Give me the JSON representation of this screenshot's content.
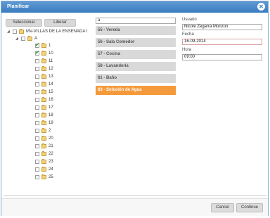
{
  "dialog": {
    "title": "Planificar"
  },
  "toolbar": {
    "select_label": "Seleccionar",
    "release_label": "Liberar"
  },
  "tree": {
    "root_label": "MV-VILLAS DE LA ENSENADA I",
    "group_label": "A",
    "items": [
      {
        "label": "1",
        "checked": true
      },
      {
        "label": "10",
        "checked": true
      },
      {
        "label": "11",
        "checked": false
      },
      {
        "label": "12",
        "checked": false
      },
      {
        "label": "13",
        "checked": false
      },
      {
        "label": "14",
        "checked": false
      },
      {
        "label": "15",
        "checked": false
      },
      {
        "label": "16",
        "checked": false
      },
      {
        "label": "17",
        "checked": false
      },
      {
        "label": "18",
        "checked": false
      },
      {
        "label": "19",
        "checked": false
      },
      {
        "label": "2",
        "checked": false
      },
      {
        "label": "20",
        "checked": false
      },
      {
        "label": "21",
        "checked": false
      },
      {
        "label": "22",
        "checked": false
      },
      {
        "label": "23",
        "checked": false
      },
      {
        "label": "24",
        "checked": false
      },
      {
        "label": "25",
        "checked": false
      }
    ]
  },
  "filter": {
    "value": "a"
  },
  "rooms": [
    {
      "label": "55 - Vereda",
      "selected": false
    },
    {
      "label": "56 - Sala Comedor",
      "selected": false
    },
    {
      "label": "57 - Cocina",
      "selected": false
    },
    {
      "label": "58 - Lavandería",
      "selected": false
    },
    {
      "label": "61 - Baño",
      "selected": false
    },
    {
      "label": "63 - Solución de Agua",
      "selected": true
    }
  ],
  "form": {
    "user_label": "Usuario",
    "user_value": "Nicole Zegarra Monzon",
    "date_label": "Fecha",
    "date_value": "16-09-2014",
    "time_label": "Hora",
    "time_value": "09:00"
  },
  "footer": {
    "cancel_label": "Cancel",
    "continue_label": "Continue"
  },
  "colors": {
    "titlebar": "#3a7cc0",
    "selected_room": "#f49a3a"
  }
}
